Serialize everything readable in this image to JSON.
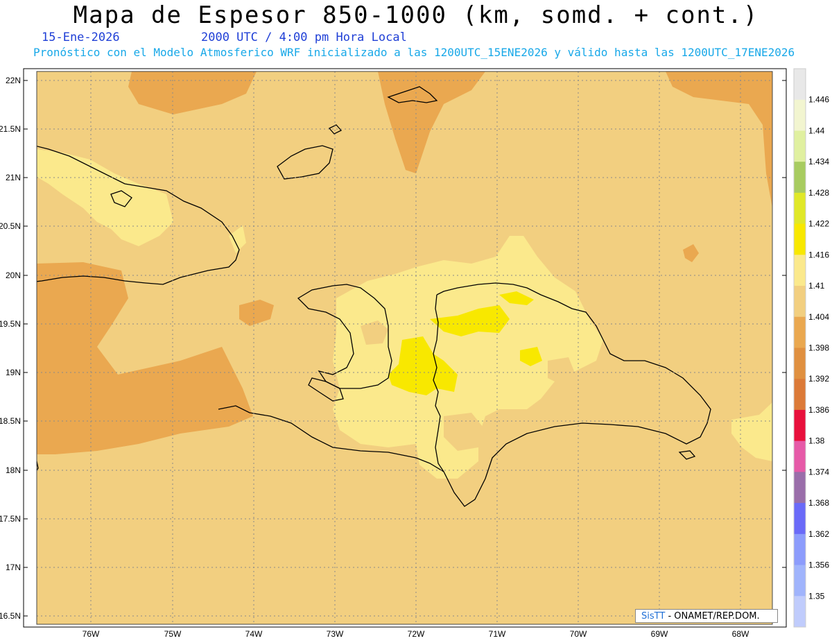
{
  "header": {
    "title": "Mapa de Espesor 850-1000 (km, somd. + cont.)",
    "date": "15-Ene-2026",
    "time": "2000 UTC / 4:00 pm Hora Local",
    "model_line": "Pronóstico con el Modelo Atmosferico WRF inicializado a las 1200UTC_15ENE2026 y válido hasta las  1200UTC_17ENE2026"
  },
  "credit": {
    "brand": "SisTT",
    "text": "- ONAMET/REP.DOM."
  },
  "axes": {
    "lat_labels": [
      "22N",
      "21.5N",
      "21N",
      "20.5N",
      "20N",
      "19.5N",
      "19N",
      "18.5N",
      "18N",
      "17.5N",
      "17N",
      "16.5N"
    ],
    "lon_labels": [
      "76W",
      "75W",
      "74W",
      "73W",
      "72W",
      "71W",
      "70W",
      "69W",
      "68W"
    ]
  },
  "colorbar": {
    "labels": [
      "1.446",
      "1.44",
      "1.434",
      "1.428",
      "1.422",
      "1.416",
      "1.41",
      "1.404",
      "1.398",
      "1.392",
      "1.386",
      "1.38",
      "1.374",
      "1.368",
      "1.362",
      "1.356",
      "1.35"
    ],
    "colors": [
      "#e8e8e8",
      "#f2f5d0",
      "#e0f0a0",
      "#a8cc60",
      "#e0e828",
      "#f8e800",
      "#fbe98c",
      "#f2cf80",
      "#eaa850",
      "#e09040",
      "#dc7a38",
      "#e8103c",
      "#e65aa8",
      "#9a6eaa",
      "#6a6af8",
      "#8c9cfc",
      "#a0b4fc",
      "#c0ccfc"
    ]
  },
  "colors": {
    "base_fill": "#f2cf80",
    "warm_fill": "#eaa850",
    "light_fill": "#fbe98c",
    "peak_fill": "#f8e800",
    "coast": "#000000",
    "grid": "#8a8a8a"
  }
}
